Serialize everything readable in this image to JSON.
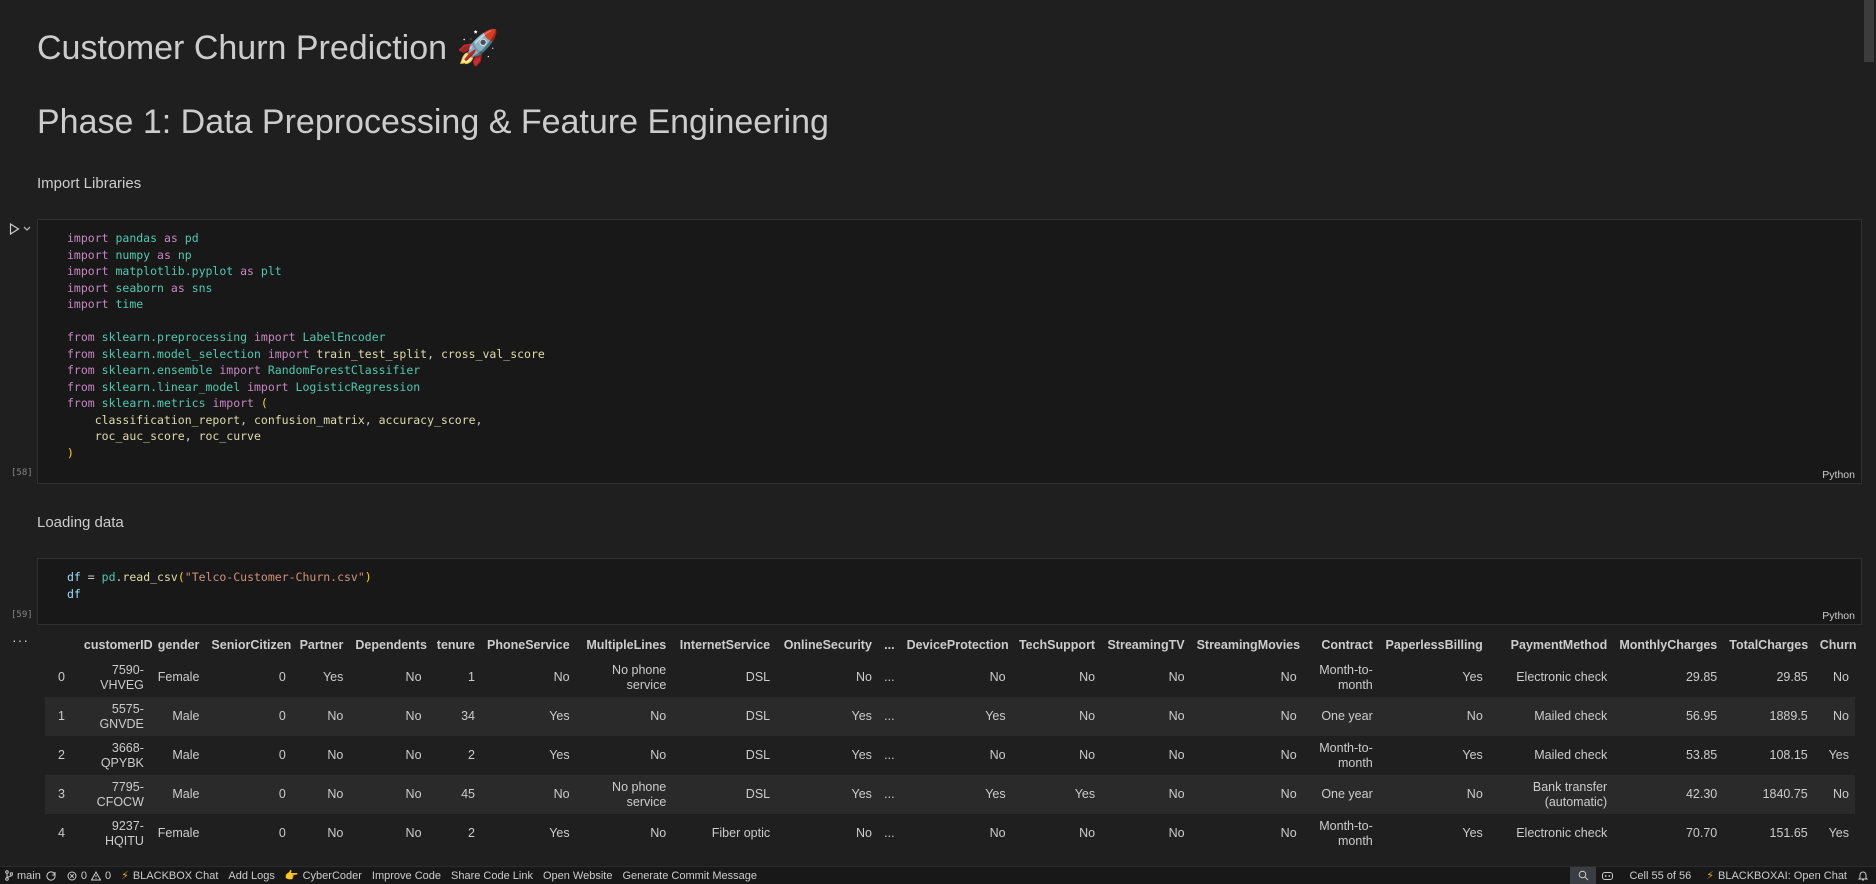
{
  "markdown": {
    "title": "Customer Churn Prediction 🚀",
    "phase": "Phase 1: Data Preprocessing & Feature Engineering",
    "import_heading": "Import Libraries",
    "loading_heading": "Loading data"
  },
  "cells": {
    "imports": {
      "execution_count": "[58]",
      "language": "Python"
    },
    "load": {
      "execution_count": "[59]",
      "language": "Python"
    }
  },
  "output": {
    "more_label": "···"
  },
  "dataframe": {
    "columns": [
      "",
      "customerID",
      "gender",
      "SeniorCitizen",
      "Partner",
      "Dependents",
      "tenure",
      "PhoneService",
      "MultipleLines",
      "InternetService",
      "OnlineSecurity",
      "...",
      "DeviceProtection",
      "TechSupport",
      "StreamingTV",
      "StreamingMovies",
      "Contract",
      "PaperlessBilling",
      "PaymentMethod",
      "MonthlyCharges",
      "TotalCharges",
      "Churn"
    ],
    "rows": [
      [
        "0",
        "7590-VHVEG",
        "Female",
        "0",
        "Yes",
        "No",
        "1",
        "No",
        "No phone service",
        "DSL",
        "No",
        "...",
        "No",
        "No",
        "No",
        "No",
        "Month-to-month",
        "Yes",
        "Electronic check",
        "29.85",
        "29.85",
        "No"
      ],
      [
        "1",
        "5575-GNVDE",
        "Male",
        "0",
        "No",
        "No",
        "34",
        "Yes",
        "No",
        "DSL",
        "Yes",
        "...",
        "Yes",
        "No",
        "No",
        "No",
        "One year",
        "No",
        "Mailed check",
        "56.95",
        "1889.5",
        "No"
      ],
      [
        "2",
        "3668-QPYBK",
        "Male",
        "0",
        "No",
        "No",
        "2",
        "Yes",
        "No",
        "DSL",
        "Yes",
        "...",
        "No",
        "No",
        "No",
        "No",
        "Month-to-month",
        "Yes",
        "Mailed check",
        "53.85",
        "108.15",
        "Yes"
      ],
      [
        "3",
        "7795-CFOCW",
        "Male",
        "0",
        "No",
        "No",
        "45",
        "No",
        "No phone service",
        "DSL",
        "Yes",
        "...",
        "Yes",
        "Yes",
        "No",
        "No",
        "One year",
        "No",
        "Bank transfer (automatic)",
        "42.30",
        "1840.75",
        "No"
      ],
      [
        "4",
        "9237-HQITU",
        "Female",
        "0",
        "No",
        "No",
        "2",
        "Yes",
        "No",
        "Fiber optic",
        "No",
        "...",
        "No",
        "No",
        "No",
        "No",
        "Month-to-month",
        "Yes",
        "Electronic check",
        "70.70",
        "151.65",
        "Yes"
      ]
    ]
  },
  "statusbar": {
    "branch": "main",
    "errors": "0",
    "warnings": "0",
    "items": [
      "BLACKBOX Chat",
      "Add Logs",
      "CyberCoder",
      "Improve Code",
      "Share Code Link",
      "Open Website",
      "Generate Commit Message"
    ],
    "cell_position": "Cell 55 of 56",
    "open_chat": "BLACKBOXAI: Open Chat"
  }
}
